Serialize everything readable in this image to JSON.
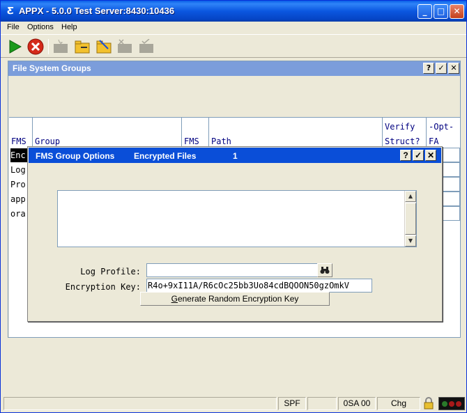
{
  "window": {
    "title": "APPX - 5.0.0 Test Server:8430:10436",
    "controls": {
      "minimize": "_",
      "maximize": "□",
      "close": "✕"
    }
  },
  "menu": [
    "File",
    "Options",
    "Help"
  ],
  "toolbar": {
    "icons": [
      "play-icon",
      "stop-icon",
      "star-folder-icon",
      "open-folder-icon",
      "edit-folder-icon",
      "delete-folder-icon",
      "check-folder-icon"
    ],
    "colors": {
      "play": "#1b9a1b",
      "stop": "#d42a1a",
      "folder": "#f2c12e",
      "disabled": "#a8a69a"
    }
  },
  "panel": {
    "title": "File System Groups",
    "buttons": {
      "help": "?",
      "ok": "✓",
      "close": "✕"
    },
    "columns": {
      "fms": "FMS",
      "group": "Group",
      "fms2": "FMS",
      "path": "Path",
      "verify_1": "Verify",
      "verify_2": "Struct?",
      "opt_1": "-Opt-",
      "opt_2": "FA"
    },
    "rows": [
      "Enc",
      "Log",
      "Pro",
      "app",
      "ora"
    ]
  },
  "dialog": {
    "title": "FMS Group Options",
    "subtitle": "Encrypted Files",
    "number": "1",
    "buttons": {
      "help": "?",
      "ok": "✓",
      "close": "✕"
    },
    "log_profile_label": "Log Profile:",
    "log_profile_value": "",
    "encryption_key_label": "Encryption Key:",
    "encryption_key_value": "R4o+9xI11A/R6cOc25bb3Uo84cdBQOON50gzOmkV",
    "generate_button": "Generate Random Encryption Key",
    "generate_button_mnemonic": "G",
    "generate_button_rest": "enerate Random Encryption Key"
  },
  "statusbar": {
    "fields": [
      "",
      "SPF",
      "",
      "0SA 00",
      "Chg"
    ],
    "lock_icon": "lock-icon",
    "lights": [
      "#2a7a2a",
      "#a81a1a",
      "#a81a1a"
    ]
  }
}
